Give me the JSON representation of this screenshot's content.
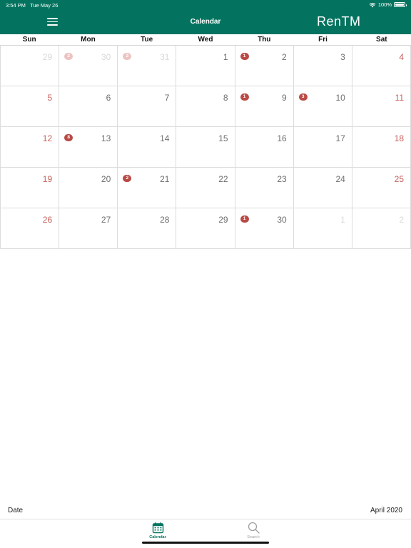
{
  "status_bar": {
    "time": "3:54 PM",
    "date": "Tue May 26",
    "battery_text": "100%",
    "battery_level": 1.0
  },
  "nav": {
    "title": "Calendar",
    "logo_text": "RenTM"
  },
  "weekdays": [
    "Sun",
    "Mon",
    "Tue",
    "Wed",
    "Thu",
    "Fri",
    "Sat"
  ],
  "days": [
    {
      "label": "29",
      "outside": true
    },
    {
      "label": "30",
      "outside": true,
      "badge": "2"
    },
    {
      "label": "31",
      "outside": true,
      "badge": "2"
    },
    {
      "label": "1"
    },
    {
      "label": "2",
      "badge": "1"
    },
    {
      "label": "3"
    },
    {
      "label": "4"
    },
    {
      "label": "5"
    },
    {
      "label": "6"
    },
    {
      "label": "7"
    },
    {
      "label": "8"
    },
    {
      "label": "9",
      "badge": "1"
    },
    {
      "label": "10",
      "badge": "3"
    },
    {
      "label": "11"
    },
    {
      "label": "12"
    },
    {
      "label": "13",
      "badge": "8"
    },
    {
      "label": "14"
    },
    {
      "label": "15"
    },
    {
      "label": "16"
    },
    {
      "label": "17"
    },
    {
      "label": "18"
    },
    {
      "label": "19"
    },
    {
      "label": "20"
    },
    {
      "label": "21",
      "badge": "2"
    },
    {
      "label": "22"
    },
    {
      "label": "23"
    },
    {
      "label": "24"
    },
    {
      "label": "25"
    },
    {
      "label": "26"
    },
    {
      "label": "27"
    },
    {
      "label": "28"
    },
    {
      "label": "29"
    },
    {
      "label": "30",
      "badge": "1"
    },
    {
      "label": "1",
      "outside": true
    },
    {
      "label": "2",
      "outside": true
    }
  ],
  "footer": {
    "label": "Date",
    "value": "April 2020"
  },
  "tabs": {
    "calendar": {
      "label": "Calendar",
      "icon": "calendar-icon"
    },
    "search": {
      "label": "Search",
      "icon": "search-icon"
    }
  },
  "colors": {
    "brand": "#03735f",
    "badge": "#b94a45",
    "badge_outside": "#ecc4c2",
    "weekend": "#c8625e",
    "outside_text": "#d9d9d9"
  }
}
